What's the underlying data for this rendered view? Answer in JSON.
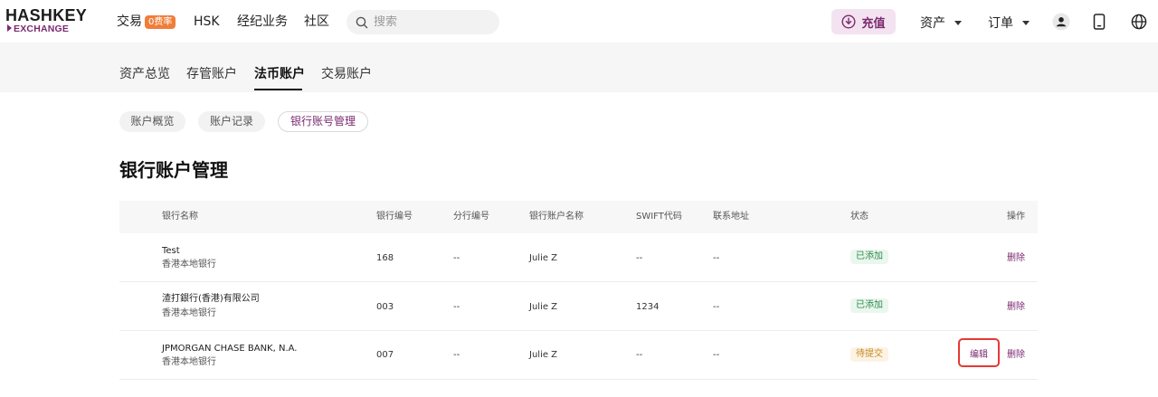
{
  "logo": {
    "line1": "HASHKEY",
    "line2": "EXCHANGE"
  },
  "nav": {
    "trade": "交易",
    "trade_badge": "0费率",
    "hsk": "HSK",
    "brokerage": "经纪业务",
    "community": "社区"
  },
  "search": {
    "placeholder": "搜索"
  },
  "deposit_label": "充值",
  "assets_label": "资产",
  "orders_label": "订单",
  "account_tabs": [
    "资产总览",
    "存管账户",
    "法币账户",
    "交易账户"
  ],
  "sub_tabs": [
    "账户概览",
    "账户记录",
    "银行账号管理"
  ],
  "page_title": "银行账户管理",
  "table": {
    "headers": [
      "银行名称",
      "银行编号",
      "分行编号",
      "银行账户名称",
      "SWIFT代码",
      "联系地址",
      "状态",
      "操作"
    ],
    "rows": [
      {
        "bank_name": "Test",
        "bank_type": "香港本地银行",
        "bank_code": "168",
        "branch_code": "--",
        "account_name": "Julie Z",
        "swift": "--",
        "address": "--",
        "status": "已添加",
        "action_delete": "删除"
      },
      {
        "bank_name": "渣打銀行(香港)有限公司",
        "bank_type": "香港本地银行",
        "bank_code": "003",
        "branch_code": "--",
        "account_name": "Julie Z",
        "swift": "1234",
        "address": "--",
        "status": "已添加",
        "action_delete": "删除"
      },
      {
        "bank_name": "JPMORGAN CHASE BANK, N.A.",
        "bank_type": "香港本地银行",
        "bank_code": "007",
        "branch_code": "--",
        "account_name": "Julie Z",
        "swift": "--",
        "address": "--",
        "status": "待提交",
        "action_edit": "编辑",
        "action_delete": "删除"
      }
    ]
  },
  "colors": {
    "accent": "#7a2a6f",
    "badge": "#f07e3a",
    "status_added": "#2f8a4b",
    "status_pending": "#c48a28",
    "highlight": "#e53935"
  }
}
